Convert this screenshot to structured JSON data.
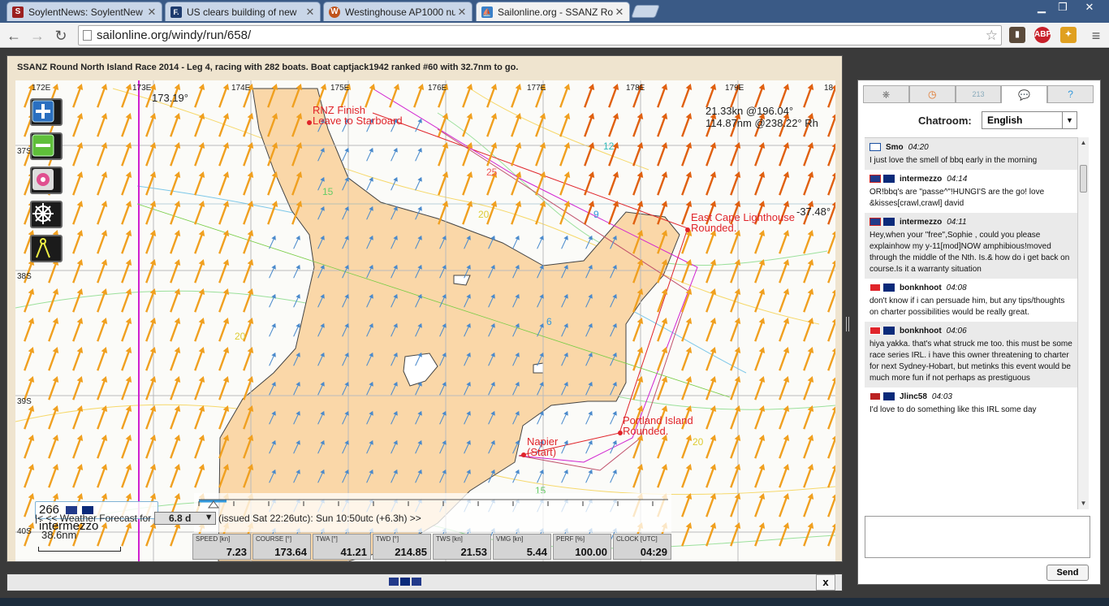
{
  "browser": {
    "tabs": [
      {
        "title": "SoylentNews: SoylentNew",
        "icon_color": "#9b2020",
        "icon_letter": "S"
      },
      {
        "title": "US clears building of new",
        "icon_color": "#1d3b6e",
        "icon_letter": "F."
      },
      {
        "title": "Westinghouse AP1000 nuc",
        "icon_color": "#c0541c",
        "icon_letter": "W"
      },
      {
        "title": "Sailonline.org - SSANZ Ro",
        "icon_color": "#3a80c8",
        "icon_letter": "⛵"
      }
    ],
    "url": "sailonline.org/windy/run/658/"
  },
  "race": {
    "title": "SSANZ Round North Island Race 2014 - Leg 4, racing with 282 boats. Boat captjack1942 ranked #60 with 32.7nm to go."
  },
  "map": {
    "lon_labels": [
      "172E",
      "173E",
      "174E",
      "175E",
      "176E",
      "177E",
      "178E",
      "179E",
      "18"
    ],
    "lat_labels": [
      "37S",
      "38S",
      "39S",
      "40S"
    ],
    "cursor_lon": "173.19°",
    "cursor_lat": "-37.48°",
    "wind_readout": "21.33kn @196.04°",
    "dtg_readout": "114.87nm @238.22° Rh",
    "marks": [
      {
        "name": "RNZ Finish Leave to Starboard",
        "line1": "RNZ Finish",
        "line2": "Leave to Starboard"
      },
      {
        "name": "East Cape Lighthouse",
        "line1": "East Cape Lighthouse",
        "line2": "Rounded."
      },
      {
        "name": "Portland Island",
        "line1": "Portland Island",
        "line2": "Rounded."
      },
      {
        "name": "Napier",
        "line1": "Napier",
        "line2": "(Start)"
      }
    ],
    "isobar_labels": [
      "15",
      "20",
      "25",
      "12",
      "9",
      "6",
      "20",
      "15",
      "20"
    ],
    "boat": {
      "rank": "266",
      "name": "intermezzo"
    },
    "scale_label": "38.6nm"
  },
  "weather": {
    "prefix": "|< << Weather Forecast for",
    "range": "6.8 d",
    "issued": "(issued Sat 22:26utc): Sun 10:50utc  (+6.3h)  >>"
  },
  "instruments": [
    {
      "label": "SPEED [kn]",
      "value": "7.23"
    },
    {
      "label": "COURSE [°]",
      "value": "173.64"
    },
    {
      "label": "TWA [°]",
      "value": "41.21"
    },
    {
      "label": "TWD [°]",
      "value": "214.85"
    },
    {
      "label": "TWS [kn]",
      "value": "21.53"
    },
    {
      "label": "VMG [kn]",
      "value": "5.44"
    },
    {
      "label": "PERF [%]",
      "value": "100.00"
    },
    {
      "label": "CLOCK [UTC]",
      "value": "04:29"
    }
  ],
  "bottombar": {
    "close": "x"
  },
  "chat": {
    "label": "Chatroom:",
    "language": "English",
    "tab_badge": "213",
    "messages": [
      {
        "user": "Smo",
        "time": "04:20",
        "flag": "fi",
        "text": "I just love the smell of bbq early in the morning"
      },
      {
        "user": "intermezzo",
        "time": "04:14",
        "flag": "au",
        "text": "OR!bbq's are \"passe^\"!HUNGI'S are the go! love &kisses[crawl,crawl] david"
      },
      {
        "user": "intermezzo",
        "time": "04:11",
        "flag": "au",
        "text": "Hey,when your \"free\",Sophie , could you please explainhow my y-11[mod]NOW amphibious!moved through the middle of the Nth. Is.& how do i get back on course.Is it a warranty situation"
      },
      {
        "user": "bonknhoot",
        "time": "04:08",
        "flag": "ch",
        "text": "don't know if i can persuade him, but any tips/thoughts on charter possibilities would be really great."
      },
      {
        "user": "bonknhoot",
        "time": "04:06",
        "flag": "ch",
        "text": "hiya yakka. that's what struck me too. this must be some race series IRL. i have this owner threatening to charter for next Sydney-Hobart, but metinks this event would be much more fun if not perhaps as prestiguous"
      },
      {
        "user": "Jlinc58",
        "time": "04:03",
        "flag": "us",
        "text": "I'd love to do something like this IRL some day"
      }
    ],
    "send_label": "Send"
  }
}
